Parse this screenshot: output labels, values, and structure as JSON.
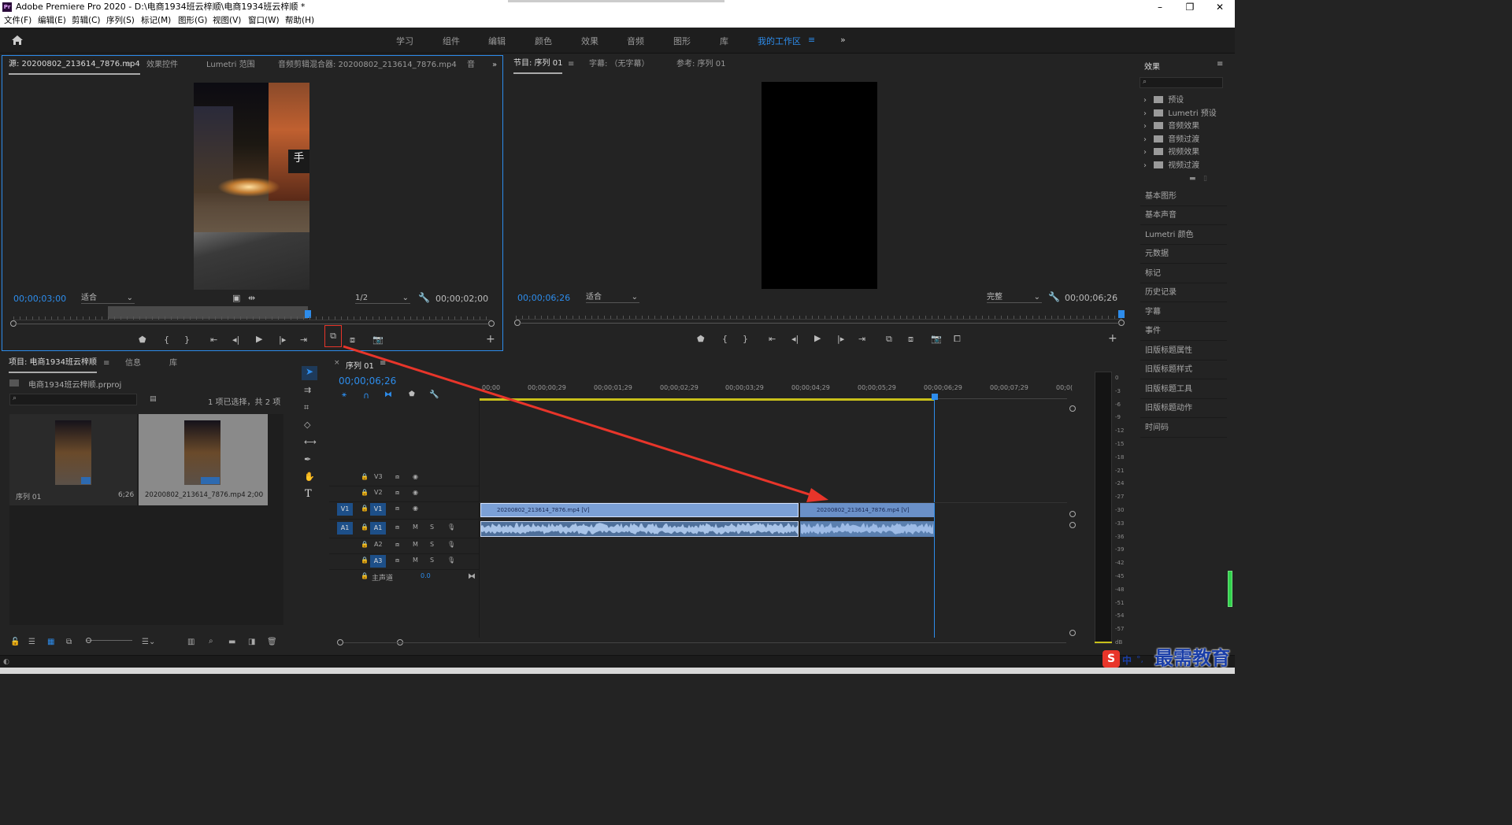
{
  "app": {
    "title": "Adobe Premiere Pro 2020 - D:\\电商1934班云梓顺\\电商1934班云梓顺 *",
    "logo_text": "Pr"
  },
  "menu": [
    "文件(F)",
    "编辑(E)",
    "剪辑(C)",
    "序列(S)",
    "标记(M)",
    "图形(G)",
    "视图(V)",
    "窗口(W)",
    "帮助(H)"
  ],
  "workspaces": [
    "学习",
    "组件",
    "编辑",
    "颜色",
    "效果",
    "音频",
    "图形",
    "库",
    "我的工作区"
  ],
  "workspace_more": "»",
  "source": {
    "tabs": [
      "源: 20200802_213614_7876.mp4",
      "效果控件",
      "Lumetri 范围",
      "音频剪辑混合器: 20200802_213614_7876.mp4",
      "音"
    ],
    "timecode": "00;00;03;00",
    "fit": "适合",
    "quality": "1/2",
    "duration": "00;00;02;00"
  },
  "program": {
    "tabs": [
      "节目: 序列 01",
      "字幕: （无字幕）",
      "参考: 序列 01"
    ],
    "timecode": "00;00;06;26",
    "fit": "适合",
    "quality": "完整",
    "duration": "00;00;06;26"
  },
  "project": {
    "tabs": [
      "项目: 电商1934班云梓顺",
      "信息",
      "库"
    ],
    "file": "电商1934班云梓顺.prproj",
    "selection": "1 项已选择，共 2 项",
    "items": [
      {
        "name": "序列 01",
        "duration": "6;26"
      },
      {
        "name": "20200802_213614_7876.mp4",
        "duration": "2;00"
      }
    ]
  },
  "timeline": {
    "tab": "序列 01",
    "timecode": "00;00;06;26",
    "ruler": [
      "00;00",
      "00;00;00;29",
      "00;00;01;29",
      "00;00;02;29",
      "00;00;03;29",
      "00;00;04;29",
      "00;00;05;29",
      "00;00;06;29",
      "00;00;07;29",
      "00;0("
    ],
    "tracks": [
      {
        "src": "",
        "name": "V3"
      },
      {
        "src": "",
        "name": "V2"
      },
      {
        "src": "V1",
        "name": "V1"
      },
      {
        "src": "A1",
        "name": "A1"
      },
      {
        "src": "",
        "name": "A2"
      },
      {
        "src": "",
        "name": "A3"
      }
    ],
    "master": {
      "label": "主声道",
      "value": "0.0"
    },
    "clips": [
      "20200802_213614_7876.mp4 [V]",
      "20200802_213614_7876.mp4 [V]"
    ],
    "ms": {
      "m": "M",
      "s": "S"
    }
  },
  "effects": {
    "title": "效果",
    "tree": [
      "预设",
      "Lumetri 预设",
      "音频效果",
      "音频过渡",
      "视频效果",
      "视频过渡"
    ],
    "panels": [
      "基本图形",
      "基本声音",
      "Lumetri 颜色",
      "元数据",
      "标记",
      "历史记录",
      "字幕",
      "事件",
      "旧版标题属性",
      "旧版标题样式",
      "旧版标题工具",
      "旧版标题动作",
      "时间码"
    ]
  },
  "meter": {
    "labels": [
      "0",
      "-3",
      "-6",
      "-9",
      "-12",
      "-15",
      "-18",
      "-21",
      "-24",
      "-27",
      "-30",
      "-33",
      "-36",
      "-39",
      "-42",
      "-45",
      "-48",
      "-51",
      "-54",
      "-57",
      "dB"
    ]
  },
  "watermark": {
    "text": "最需教育",
    "ime": "中"
  },
  "colors": {
    "accent": "#2d8ceb",
    "arrow": "#e8352a",
    "clip": "#7ba0d6"
  }
}
